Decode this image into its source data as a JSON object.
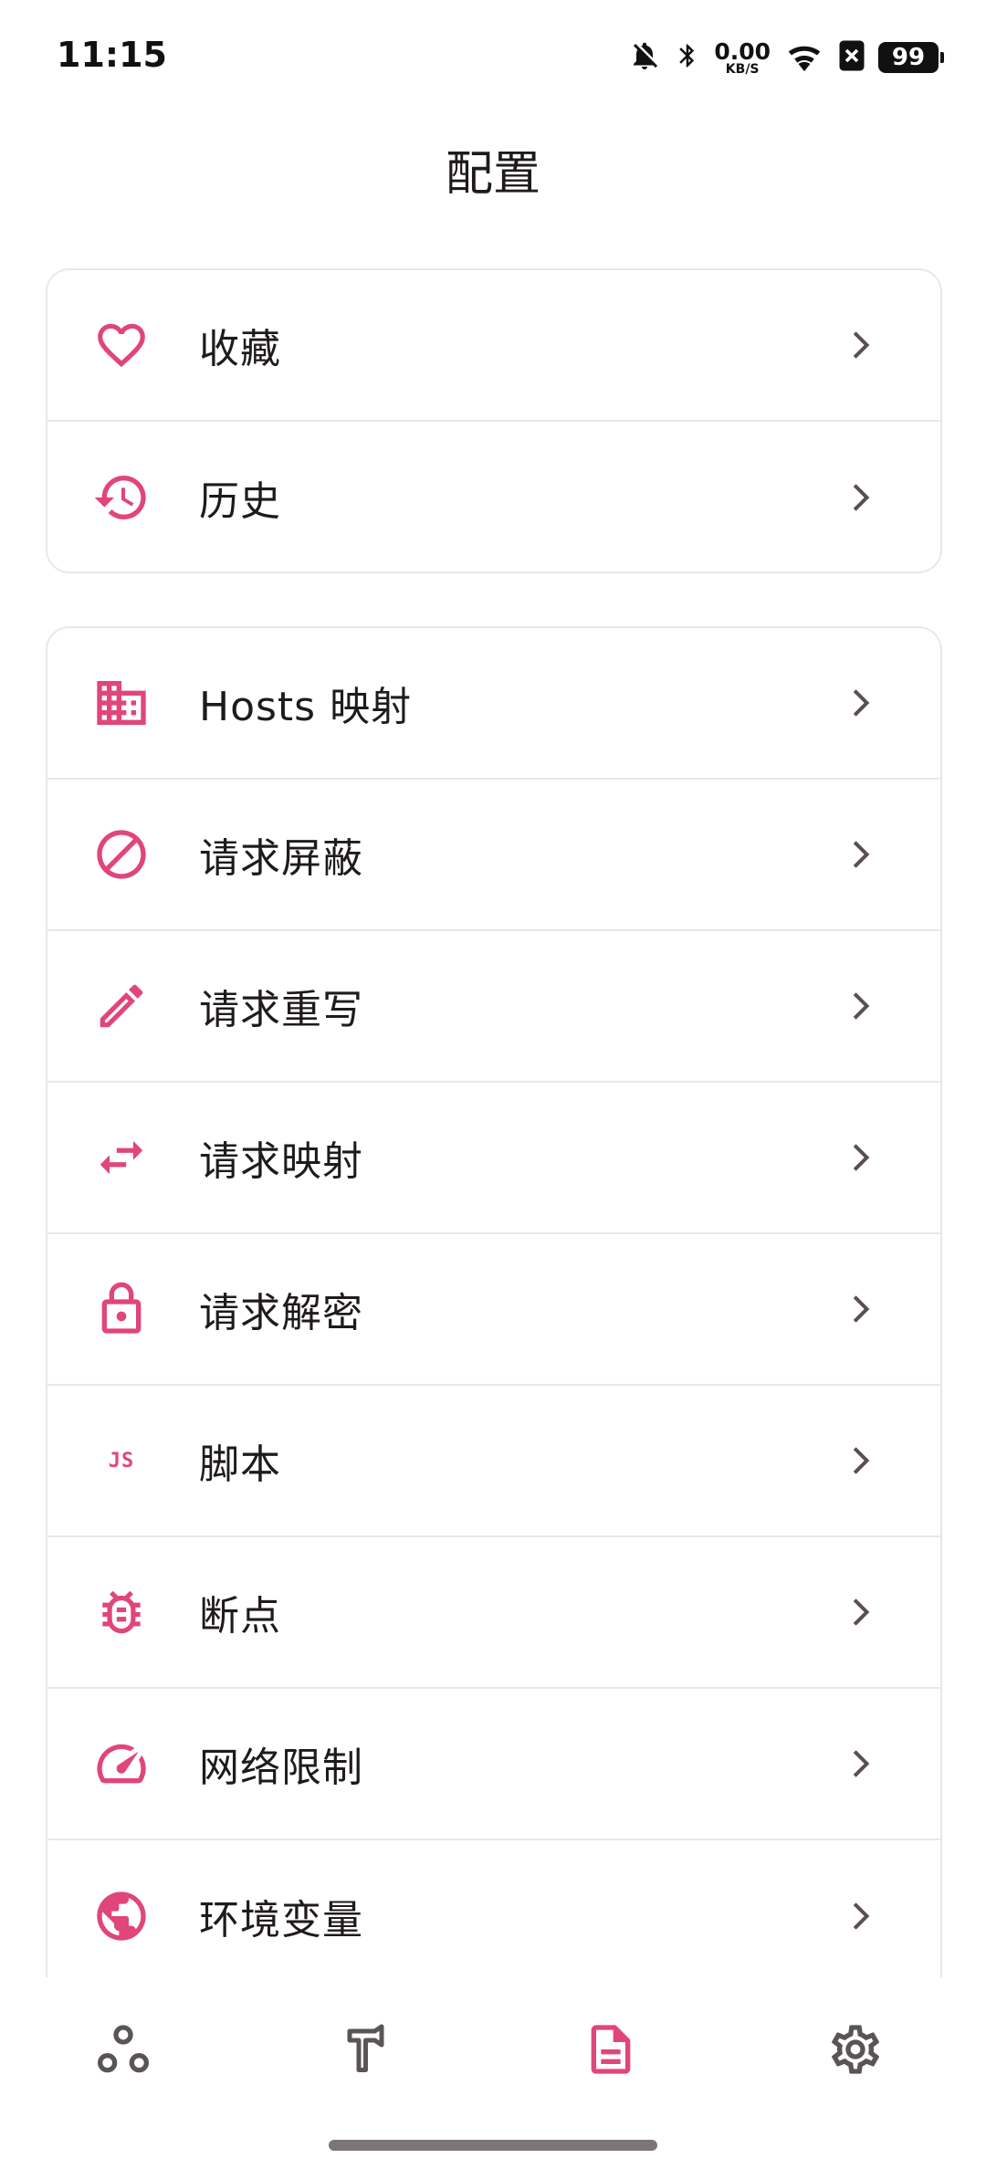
{
  "status_bar": {
    "time": "11:15",
    "net_speed_value": "0.00",
    "net_speed_unit": "KB/S",
    "battery": "99"
  },
  "page": {
    "title": "配置"
  },
  "colors": {
    "accent": "#e0457b",
    "chevron": "#5a4e52",
    "nav_inactive": "#5a5457"
  },
  "groups": [
    {
      "items": [
        {
          "label": "收藏",
          "icon": "heart-icon"
        },
        {
          "label": "历史",
          "icon": "history-icon"
        }
      ]
    },
    {
      "items": [
        {
          "label": "Hosts 映射",
          "icon": "domain-icon"
        },
        {
          "label": "请求屏蔽",
          "icon": "block-icon"
        },
        {
          "label": "请求重写",
          "icon": "pencil-icon"
        },
        {
          "label": "请求映射",
          "icon": "swap-arrows-icon"
        },
        {
          "label": "请求解密",
          "icon": "lock-icon"
        },
        {
          "label": "脚本",
          "icon": "javascript-icon",
          "icon_text": "JS"
        },
        {
          "label": "断点",
          "icon": "bug-icon"
        },
        {
          "label": "网络限制",
          "icon": "speed-gauge-icon"
        },
        {
          "label": "环境变量",
          "icon": "globe-icon"
        }
      ]
    }
  ],
  "bottom_nav": {
    "tabs": [
      {
        "name": "network",
        "icon": "nodes-icon",
        "active": false
      },
      {
        "name": "tools",
        "icon": "hammer-icon",
        "active": false
      },
      {
        "name": "config",
        "icon": "document-icon",
        "active": true
      },
      {
        "name": "settings",
        "icon": "gear-icon",
        "active": false
      }
    ]
  }
}
